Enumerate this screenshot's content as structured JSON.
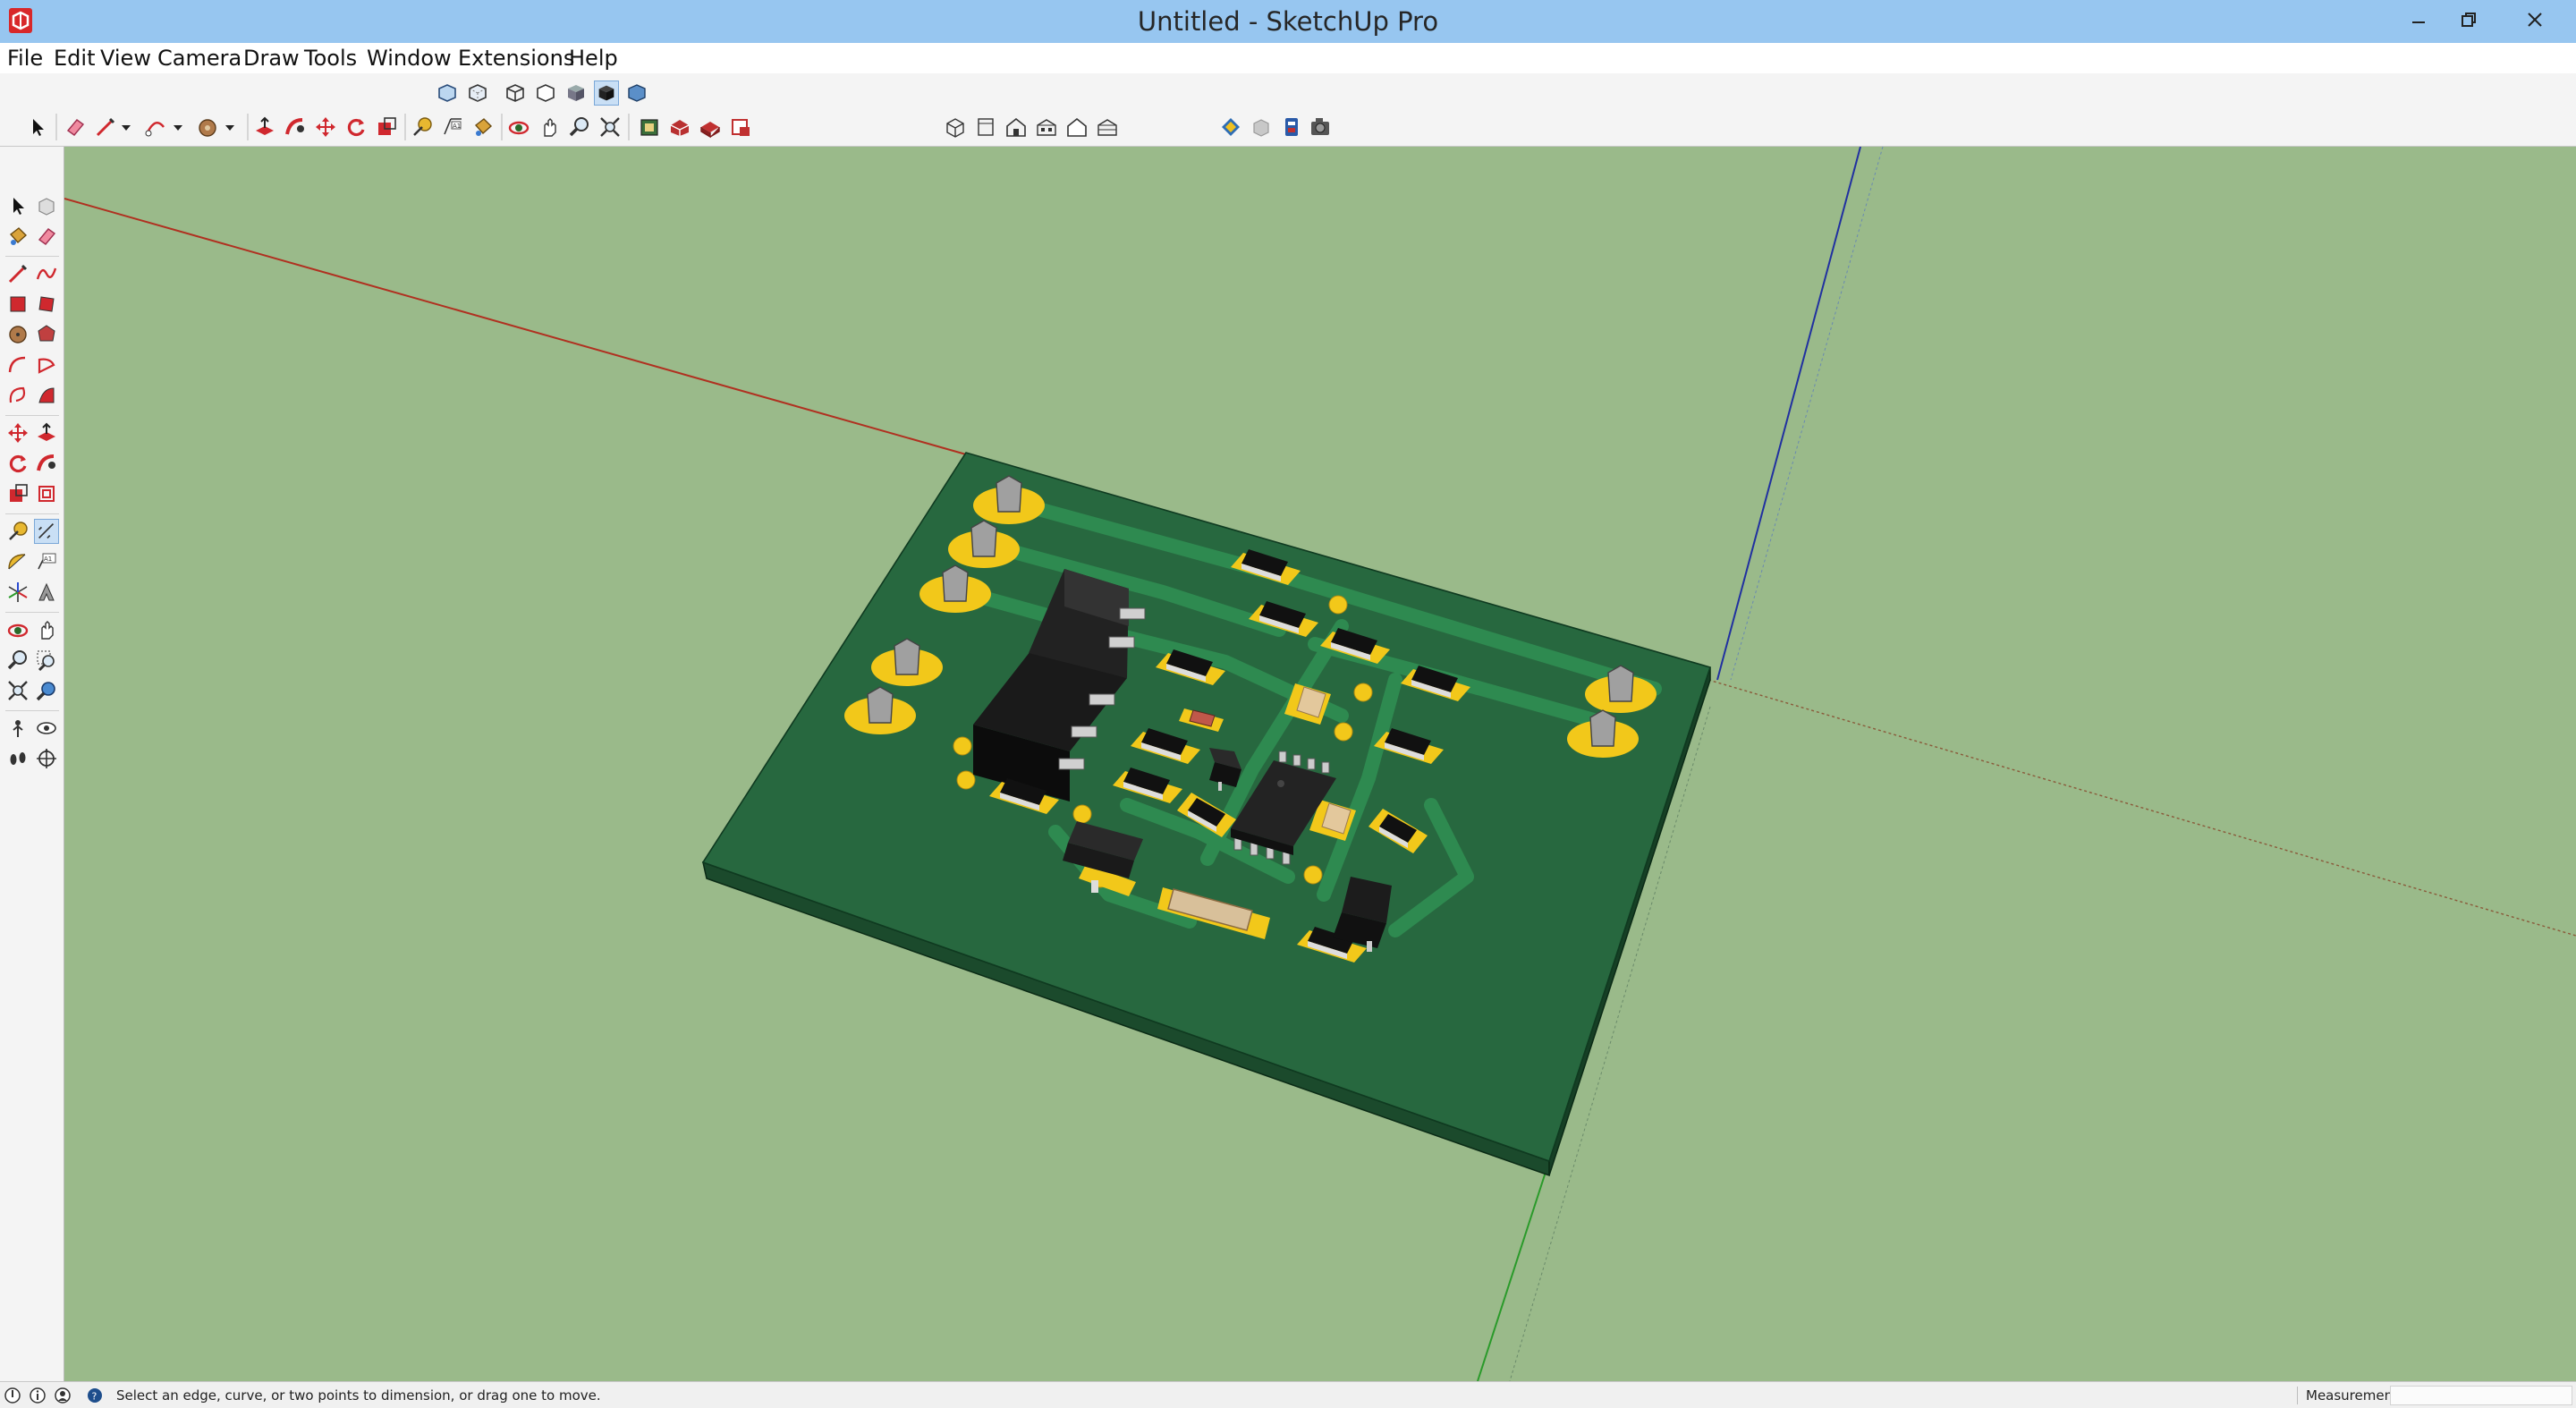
{
  "window": {
    "title": "Untitled - SketchUp Pro",
    "colors": {
      "titlebar": "#97c6f0",
      "viewport_bg": "#9aba8a",
      "board": "#27683f",
      "pads": "#f2c81a"
    }
  },
  "menu": {
    "items": [
      "File",
      "Edit",
      "View",
      "Camera",
      "Draw",
      "Tools",
      "Window",
      "Extensions",
      "Help"
    ]
  },
  "toolbars": {
    "styles_row": [
      "xray-icon",
      "back-edges-icon",
      "wireframe-icon",
      "hidden-line-icon",
      "shaded-icon",
      "shaded-with-textures-icon",
      "monochrome-icon"
    ],
    "styles_active": "shaded-with-textures-icon",
    "main_row": [
      "select-icon",
      "eraser-icon",
      "line-icon",
      "line-dropdown-icon",
      "arc-icon",
      "arc-dropdown-icon",
      "shape-icon",
      "shape-dropdown-icon",
      "push-pull-icon",
      "follow-me-icon",
      "move-icon",
      "rotate-icon",
      "scale-icon",
      "tape-measure-icon",
      "dimension-icon",
      "paint-bucket-icon",
      "orbit-icon",
      "pan-icon",
      "zoom-icon",
      "zoom-extents-icon",
      "3d-warehouse-icon",
      "extension-warehouse-icon",
      "layout-icon",
      "send-to-layout-icon"
    ],
    "views_row": [
      "iso-view-icon",
      "top-view-icon",
      "front-view-icon",
      "right-view-icon",
      "back-view-icon",
      "left-view-icon"
    ],
    "extra_row": [
      "kicad-icon",
      "component-icon",
      "ruby-icon",
      "camera-icon"
    ]
  },
  "left_palette": {
    "tools": [
      "select-icon",
      "make-component-icon",
      "paint-bucket-icon",
      "eraser-icon",
      "line-icon",
      "freehand-icon",
      "rectangle-icon",
      "rotated-rectangle-icon",
      "circle-icon",
      "polygon-icon",
      "arc-icon",
      "pie-icon",
      "two-point-arc-icon",
      "three-point-arc-icon",
      "move-icon",
      "push-pull-icon",
      "rotate-icon",
      "follow-me-icon",
      "scale-icon",
      "offset-icon",
      "tape-measure-icon",
      "dimension-icon",
      "protractor-icon",
      "text-icon",
      "axes-icon",
      "3d-text-icon",
      "orbit-icon",
      "pan-icon",
      "zoom-icon",
      "zoom-window-icon",
      "zoom-extents-icon",
      "previous-view-icon",
      "position-camera-icon",
      "look-around-icon",
      "walk-icon",
      "section-plane-icon"
    ],
    "active": "dimension-icon"
  },
  "status": {
    "hint": "Select an edge, curve, or two points to dimension, or drag one to move.",
    "measurements_label": "Measurements",
    "measurements_value": ""
  }
}
